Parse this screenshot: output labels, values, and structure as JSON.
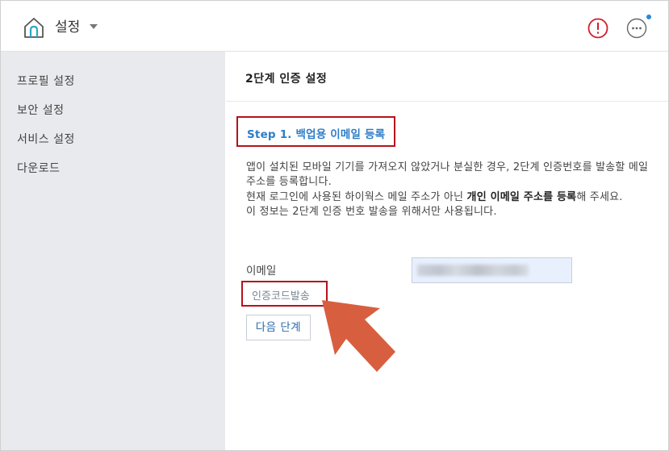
{
  "header": {
    "title": "설정",
    "icons": [
      "home-icon",
      "chevron-down-icon",
      "alert-icon",
      "more-icon"
    ],
    "colors": {
      "alert": "#d0202a",
      "notification_dot": "#2a87d8"
    }
  },
  "sidebar": {
    "items": [
      {
        "label": "프로필 설정"
      },
      {
        "label": "보안 설정"
      },
      {
        "label": "서비스 설정"
      },
      {
        "label": "다운로드"
      }
    ]
  },
  "main": {
    "title": "2단계 인증 설정",
    "step_title": "Step 1. 백업용 이메일 등록",
    "description": {
      "line1": "앱이 설치된 모바일 기기를 가져오지 않았거나 분실한 경우, 2단계 인증번호를 발송할 메일주소를 등록합니다.",
      "line2_prefix": "현재 로그인에 사용된 하이웍스 메일 주소가 아닌 ",
      "line2_bold": "개인 이메일 주소를 등록",
      "line2_suffix": "해 주세요.",
      "line3": "이 정보는 2단계 인증 번호 발송을 위해서만 사용됩니다."
    },
    "email_label": "이메일",
    "email_value": "",
    "verify_link": "인증코드발송",
    "next_button": "다음 단계"
  },
  "colors": {
    "highlight_border": "#b5121b",
    "step_title": "#2d7dc8",
    "arrow": "#d75f3f",
    "sidebar_bg": "#e8eaed"
  }
}
